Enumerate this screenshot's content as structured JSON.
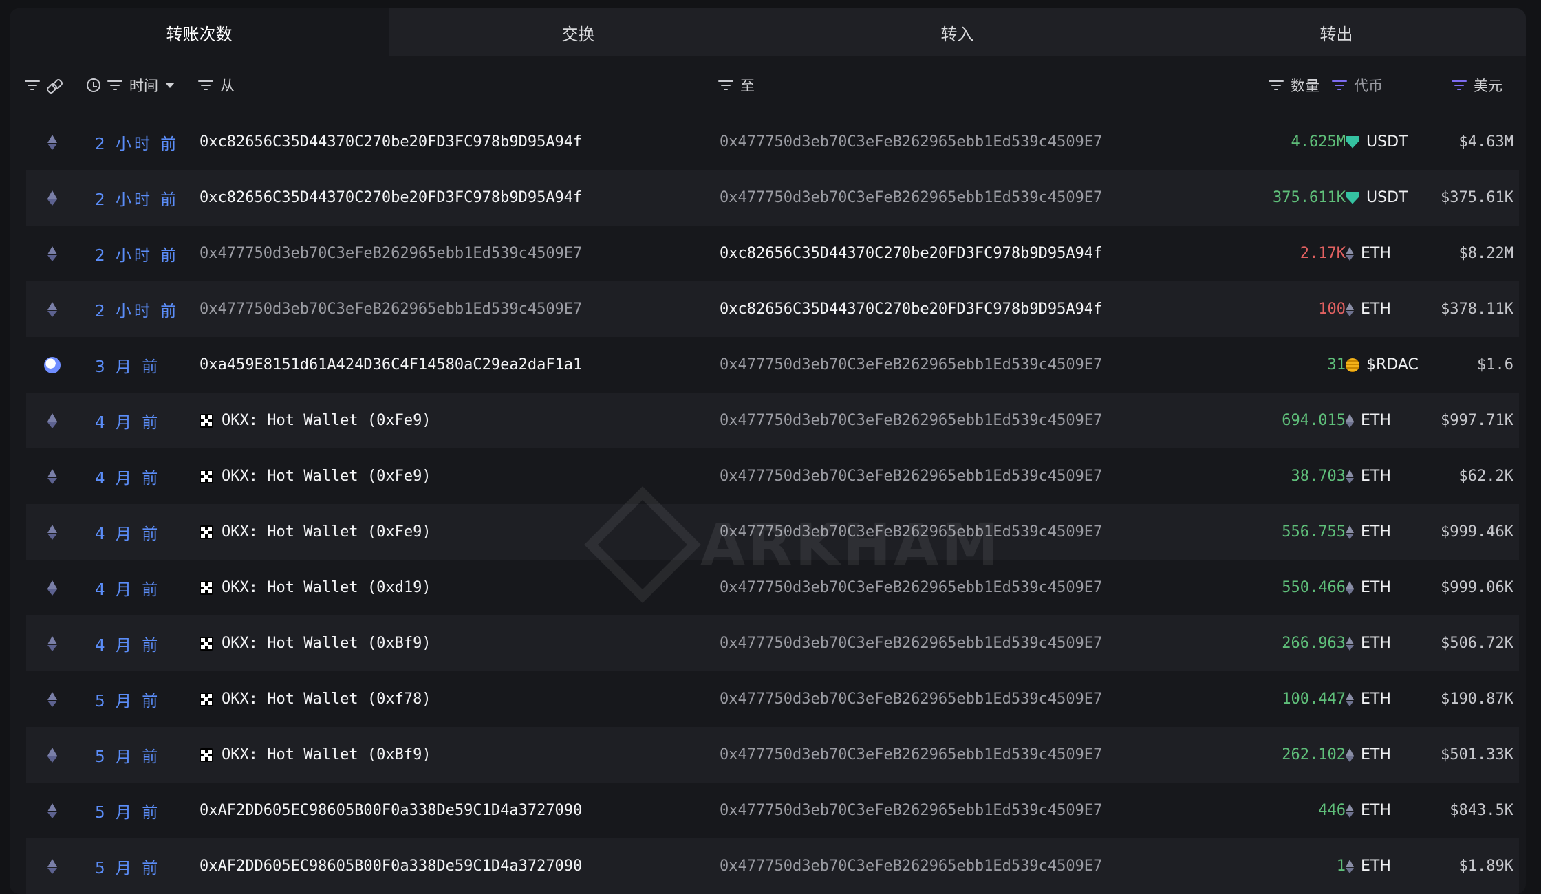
{
  "tabs": [
    {
      "label": "转账次数"
    },
    {
      "label": "交换"
    },
    {
      "label": "转入"
    },
    {
      "label": "转出"
    }
  ],
  "header": {
    "time": "时间",
    "from": "从",
    "to": "至",
    "quantity": "数量",
    "token": "代币",
    "usd": "美元"
  },
  "watermark": "ARKHAM",
  "rows": [
    {
      "time": "2 小时 前",
      "from": "0xc82656C35D44370C270be20FD3FC978b9D95A94f",
      "to": "0x477750d3eb70C3eFeB262965ebb1Ed539c4509E7",
      "qty": "4.625M",
      "token": "USDT",
      "usd": "$4.63M"
    },
    {
      "time": "2 小时 前",
      "from": "0xc82656C35D44370C270be20FD3FC978b9D95A94f",
      "to": "0x477750d3eb70C3eFeB262965ebb1Ed539c4509E7",
      "qty": "375.611K",
      "token": "USDT",
      "usd": "$375.61K"
    },
    {
      "time": "2 小时 前",
      "from": "0x477750d3eb70C3eFeB262965ebb1Ed539c4509E7",
      "to": "0xc82656C35D44370C270be20FD3FC978b9D95A94f",
      "qty": "2.17K",
      "token": "ETH",
      "usd": "$8.22M"
    },
    {
      "time": "2 小时 前",
      "from": "0x477750d3eb70C3eFeB262965ebb1Ed539c4509E7",
      "to": "0xc82656C35D44370C270be20FD3FC978b9D95A94f",
      "qty": "100",
      "token": "ETH",
      "usd": "$378.11K"
    },
    {
      "time": "3 月 前",
      "from": "0xa459E8151d61A424D36C4F14580aC29ea2daF1a1",
      "to": "0x477750d3eb70C3eFeB262965ebb1Ed539c4509E7",
      "qty": "31",
      "token": "$RDAC",
      "usd": "$1.6"
    },
    {
      "time": "4 月 前",
      "from": "OKX: Hot Wallet (0xFe9)",
      "to": "0x477750d3eb70C3eFeB262965ebb1Ed539c4509E7",
      "qty": "694.015",
      "token": "ETH",
      "usd": "$997.71K"
    },
    {
      "time": "4 月 前",
      "from": "OKX: Hot Wallet (0xFe9)",
      "to": "0x477750d3eb70C3eFeB262965ebb1Ed539c4509E7",
      "qty": "38.703",
      "token": "ETH",
      "usd": "$62.2K"
    },
    {
      "time": "4 月 前",
      "from": "OKX: Hot Wallet (0xFe9)",
      "to": "0x477750d3eb70C3eFeB262965ebb1Ed539c4509E7",
      "qty": "556.755",
      "token": "ETH",
      "usd": "$999.46K"
    },
    {
      "time": "4 月 前",
      "from": "OKX: Hot Wallet (0xd19)",
      "to": "0x477750d3eb70C3eFeB262965ebb1Ed539c4509E7",
      "qty": "550.466",
      "token": "ETH",
      "usd": "$999.06K"
    },
    {
      "time": "4 月 前",
      "from": "OKX: Hot Wallet (0xBf9)",
      "to": "0x477750d3eb70C3eFeB262965ebb1Ed539c4509E7",
      "qty": "266.963",
      "token": "ETH",
      "usd": "$506.72K"
    },
    {
      "time": "5 月 前",
      "from": "OKX: Hot Wallet (0xf78)",
      "to": "0x477750d3eb70C3eFeB262965ebb1Ed539c4509E7",
      "qty": "100.447",
      "token": "ETH",
      "usd": "$190.87K"
    },
    {
      "time": "5 月 前",
      "from": "OKX: Hot Wallet (0xBf9)",
      "to": "0x477750d3eb70C3eFeB262965ebb1Ed539c4509E7",
      "qty": "262.102",
      "token": "ETH",
      "usd": "$501.33K"
    },
    {
      "time": "5 月 前",
      "from": "0xAF2DD605EC98605B00F0a338De59C1D4a3727090",
      "to": "0x477750d3eb70C3eFeB262965ebb1Ed539c4509E7",
      "qty": "446",
      "token": "ETH",
      "usd": "$843.5K"
    },
    {
      "time": "5 月 前",
      "from": "0xAF2DD605EC98605B00F0a338De59C1D4a3727090",
      "to": "0x477750d3eb70C3eFeB262965ebb1Ed539c4509E7",
      "qty": "1",
      "token": "ETH",
      "usd": "$1.89K"
    }
  ]
}
